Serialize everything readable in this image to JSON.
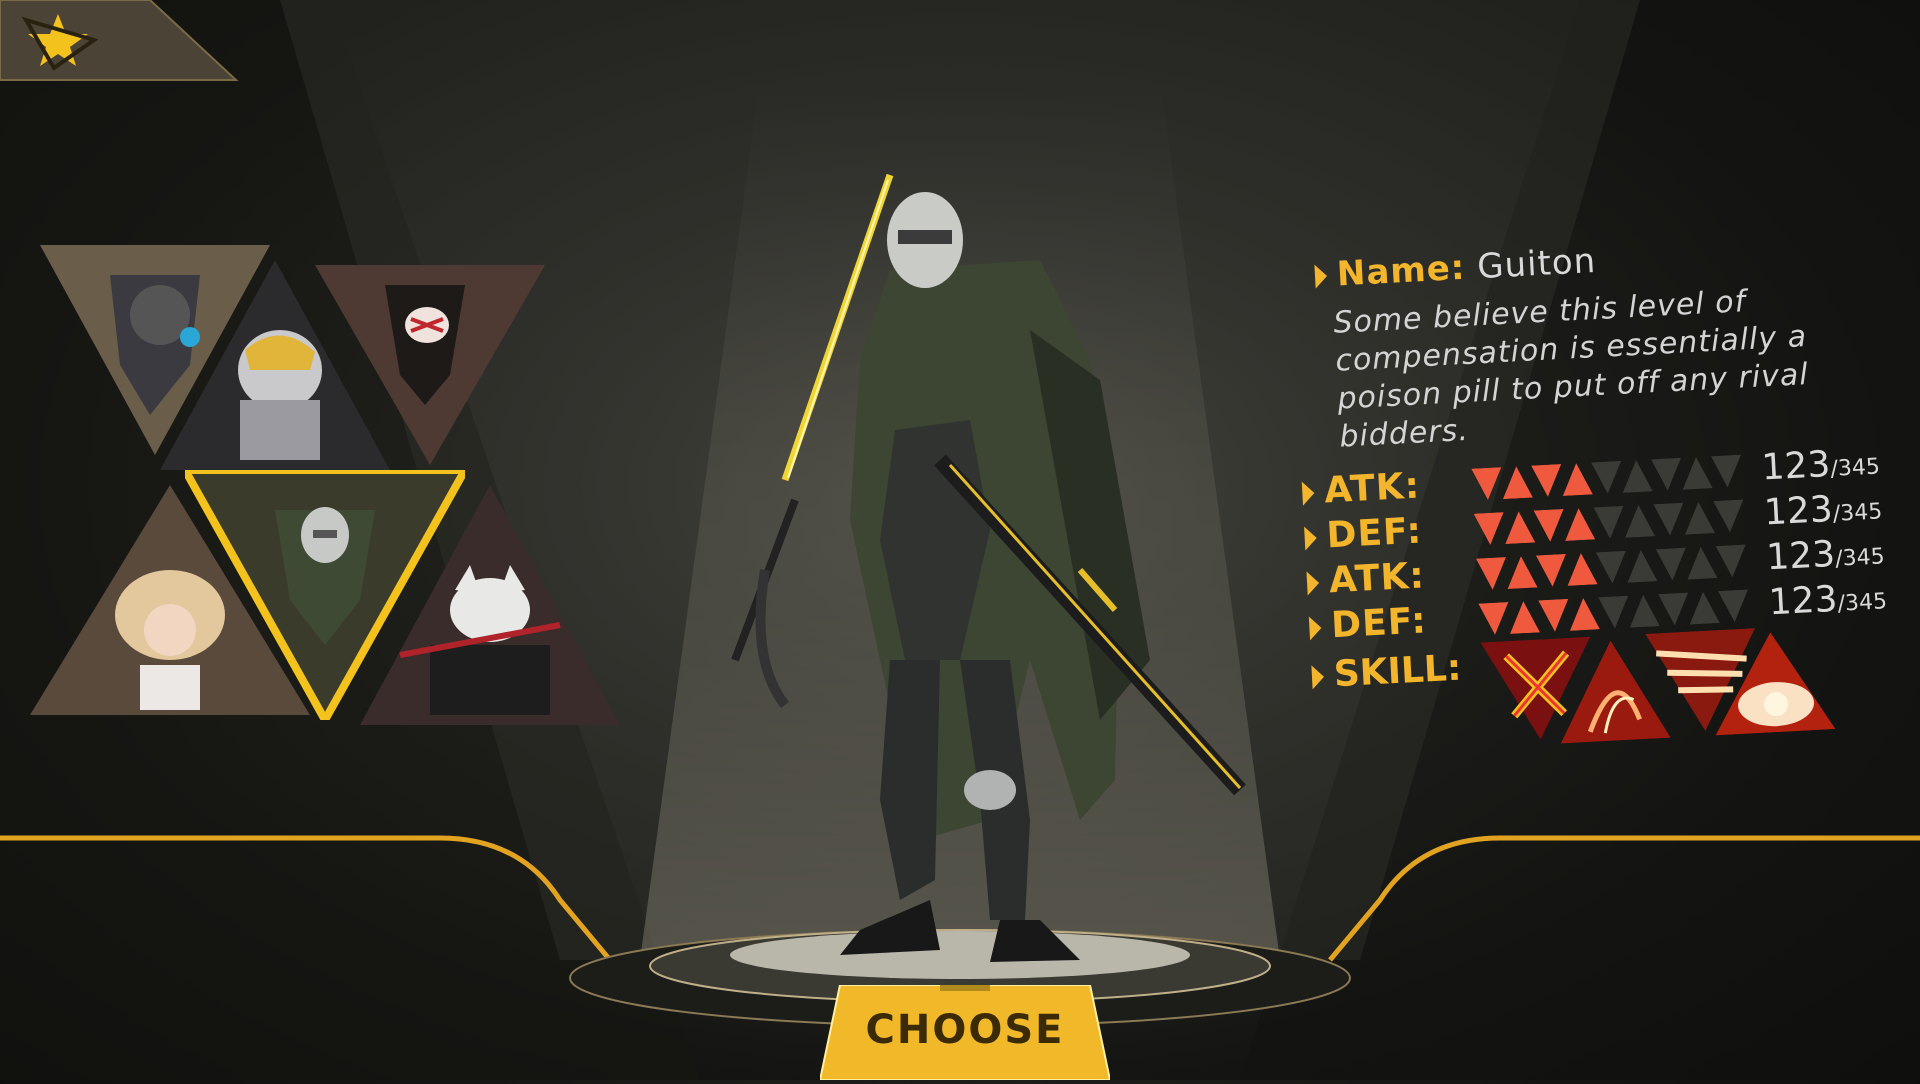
{
  "header": {
    "back_icon": "star-triangle-back-icon"
  },
  "roster": {
    "portraits": [
      {
        "name": "hooded-masked-hero",
        "selected": false
      },
      {
        "name": "armored-yellow-helmet-hero",
        "selected": false
      },
      {
        "name": "red-skull-hooded-hero",
        "selected": false
      },
      {
        "name": "blonde-girl-hero",
        "selected": false
      },
      {
        "name": "guiton-cloaked-hero",
        "selected": true
      },
      {
        "name": "white-fox-mask-hero",
        "selected": false
      }
    ]
  },
  "character": {
    "name_label": "Name:",
    "name_value": "Guiton",
    "description": "Some believe this level of compensation is essentially a poison pill to put off any rival bidders."
  },
  "stats": [
    {
      "label": "ATK:",
      "value": "123",
      "max": "/345",
      "filled": 4,
      "total": 9
    },
    {
      "label": "DEF:",
      "value": "123",
      "max": "/345",
      "filled": 4,
      "total": 9
    },
    {
      "label": "ATK:",
      "value": "123",
      "max": "/345",
      "filled": 4,
      "total": 9
    },
    {
      "label": "DEF:",
      "value": "123",
      "max": "/345",
      "filled": 4,
      "total": 9
    }
  ],
  "skills": {
    "label": "SKILL:",
    "icons": [
      "crossed-swords-skill-icon",
      "flame-slash-skill-icon",
      "fire-streak-skill-icon",
      "explosion-skill-icon"
    ]
  },
  "choose_button": {
    "label": "CHOOSE"
  },
  "colors": {
    "accent": "#f3b52c",
    "bar_fill": "#ef5a3e",
    "bar_empty": "#3a3a36"
  }
}
